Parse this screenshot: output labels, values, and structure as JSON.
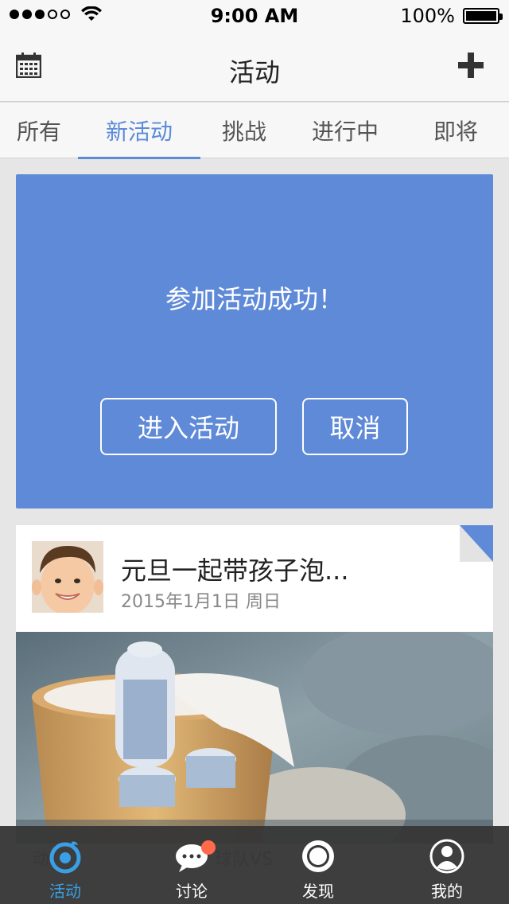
{
  "status_bar": {
    "time": "9:00 AM",
    "battery": "100%",
    "signal_dots": [
      true,
      true,
      true,
      false,
      false
    ]
  },
  "nav": {
    "title": "活动",
    "left_icon": "calendar-icon",
    "right_icon": "plus-icon"
  },
  "tabs": [
    {
      "label": "所有",
      "active": false
    },
    {
      "label": "新活动",
      "active": true
    },
    {
      "label": "挑战",
      "active": false
    },
    {
      "label": "进行中",
      "active": false
    },
    {
      "label": "即将",
      "active": false
    }
  ],
  "success_card": {
    "message": "参加活动成功！",
    "enter_label": "进入活动",
    "cancel_label": "取消",
    "color": "#5f8ad8"
  },
  "activity": {
    "title": "元旦一起带孩子泡...",
    "date": "2015年1月1日  周日"
  },
  "tab_bar": {
    "items": [
      {
        "label": "活动",
        "icon": "activity-icon",
        "active": true
      },
      {
        "label": "讨论",
        "icon": "chat-icon",
        "active": false
      },
      {
        "label": "发现",
        "icon": "discover-icon",
        "active": false
      },
      {
        "label": "我的",
        "icon": "profile-icon",
        "active": false
      }
    ],
    "accent": "#3aa0e6"
  }
}
